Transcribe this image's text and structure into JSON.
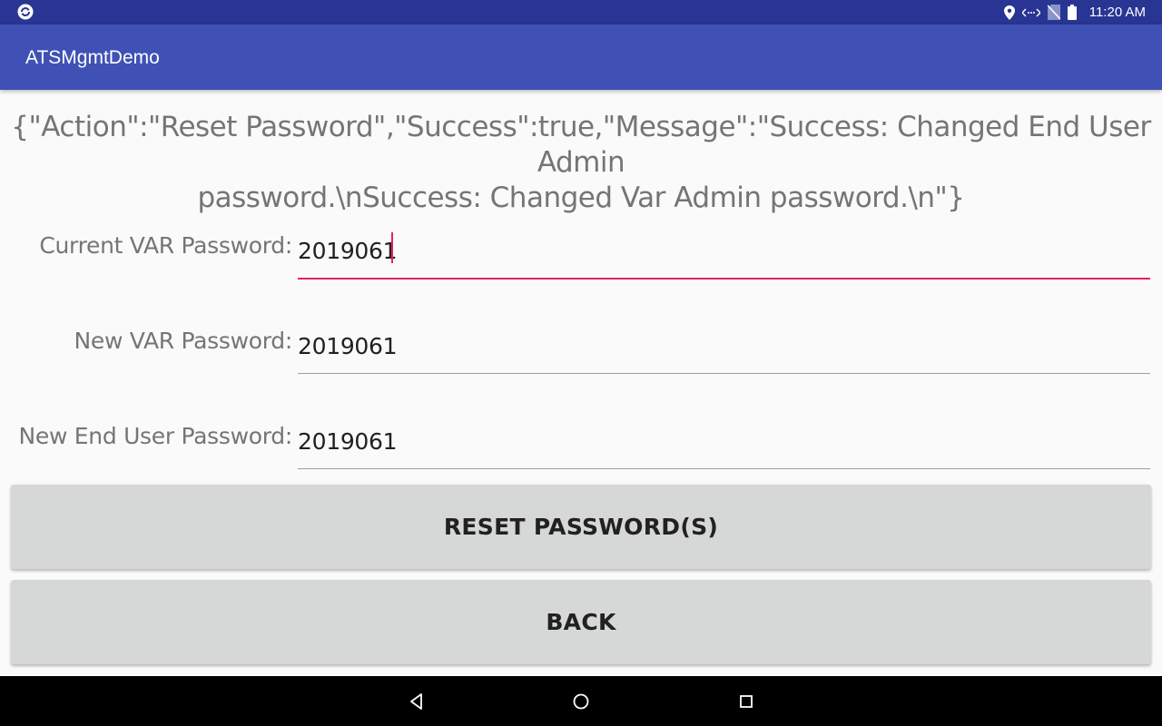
{
  "status_bar": {
    "time": "11:20 AM",
    "icons": [
      "sync-app-icon",
      "location-icon",
      "data-icon",
      "no-sim-icon",
      "battery-icon"
    ]
  },
  "app_bar": {
    "title": "ATSMgmtDemo"
  },
  "response": {
    "line1": "{\"Action\":\"Reset Password\",\"Success\":true,\"Message\":\"Success: Changed End User Admin",
    "line2": "password.\\nSuccess: Changed Var Admin password.\\n\"}"
  },
  "form": {
    "current_var": {
      "label": "Current VAR Password:",
      "value": "2019061"
    },
    "new_var": {
      "label": "New VAR Password:",
      "value": "2019061"
    },
    "new_end_user": {
      "label": "New End User Password:",
      "value": "2019061"
    }
  },
  "buttons": {
    "reset_label": "RESET PASSWORD(S)",
    "back_label": "BACK"
  },
  "nav_bar": {
    "icons": [
      "back-triangle-icon",
      "home-circle-icon",
      "recents-square-icon"
    ]
  },
  "colors": {
    "status_bar": "#283593",
    "app_bar": "#3f51b5",
    "accent": "#e91e63",
    "button": "#d6d7d7"
  }
}
